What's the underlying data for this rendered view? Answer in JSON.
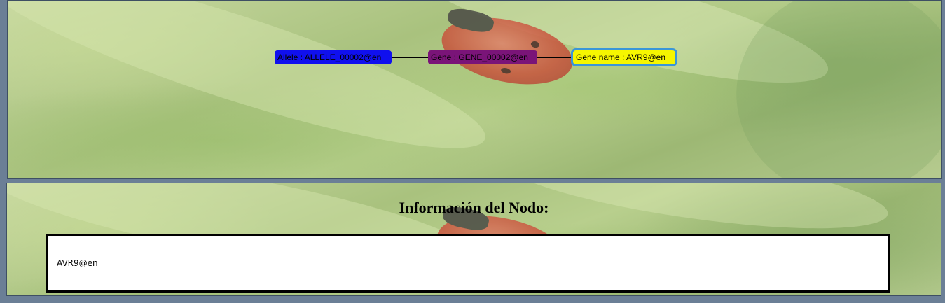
{
  "graph": {
    "nodes": [
      {
        "id": "allele",
        "label": "Allele : ALLELE_00002@en",
        "color": "#1010ee"
      },
      {
        "id": "gene",
        "label": "Gene : GENE_00002@en",
        "color": "#7a1478"
      },
      {
        "id": "gene_name",
        "label": "Gene name : AVR9@en",
        "color": "#f6f600",
        "selected": true
      }
    ],
    "edges": [
      {
        "from": "allele",
        "to": "gene"
      },
      {
        "from": "gene",
        "to": "gene_name"
      }
    ]
  },
  "info": {
    "title": "Información del Nodo:",
    "content": "AVR9@en"
  },
  "colors": {
    "page_background": "#6b7f96",
    "selection_outline": "#3a96d8"
  }
}
